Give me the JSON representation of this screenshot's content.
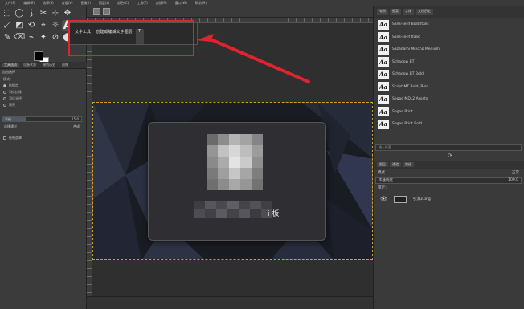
{
  "menubar": [
    "文件(F)",
    "编辑(E)",
    "选择(S)",
    "查看(V)",
    "图像(I)",
    "图层(L)",
    "颜色(C)",
    "工具(T)",
    "滤镜(R)",
    "窗口(W)",
    "帮助(H)"
  ],
  "toolbox": {
    "tools": [
      "⬚",
      "◯",
      "⟆",
      "✂",
      "⊹",
      "✥",
      "⤢",
      "◩",
      "⟲",
      "⌖",
      "☼",
      "A",
      "✎",
      "⌫",
      "⌁",
      "✦",
      "⊘",
      "⬤",
      "⛶",
      "⌕",
      "◈",
      "⟟",
      "⟡",
      "☷"
    ],
    "text_tool_glyph": "A"
  },
  "panel_tabs": [
    "工具选项",
    "设备状态",
    "撤销历史",
    "图像"
  ],
  "tool_options": {
    "title": "自由选择",
    "mode_label": "模式：",
    "antialias": "抗锯齿",
    "feather": "羽化边缘",
    "feather_radius": "羽化半径",
    "highlight": "高亮",
    "radius_label": "半径",
    "radius_value": "15.0",
    "select_label": "选择通过",
    "select_value": "合成",
    "draw_mask": "绘制遮罩"
  },
  "tooltip": {
    "text": "文字工具： 创建或编辑文字图层",
    "shortcut": "T"
  },
  "dialog": {
    "caption": "i 板"
  },
  "dock": {
    "tabs": [
      "笔刷",
      "图案",
      "字体",
      "文档历史"
    ],
    "fonts": [
      {
        "glyph": "Aa",
        "name": "Sans-serif Bold Italic"
      },
      {
        "glyph": "Aa",
        "name": "Sans-serif Italic"
      },
      {
        "glyph": "Aa",
        "name": "Sazanami Mincho Medium"
      },
      {
        "glyph": "Aa",
        "name": "Schadow BT"
      },
      {
        "glyph": "Aa",
        "name": "Schadow BT Bold"
      },
      {
        "glyph": "Aa",
        "name": "Script MT Bold, Bold"
      },
      {
        "glyph": "Aa",
        "name": "Segoe MDL2 Assets"
      },
      {
        "glyph": "Aa",
        "name": "Segoe Print"
      },
      {
        "glyph": "Aa",
        "name": "Segoe Print Bold"
      }
    ],
    "font_search_placeholder": "输入标签",
    "layers_tabs": [
      "图层",
      "通道",
      "路径"
    ],
    "mode_label": "模式",
    "mode_value": "正常",
    "opacity_label": "不透明度",
    "opacity_value": "100.0",
    "lock_label": "锁定：",
    "layer_name": "引流3.png"
  }
}
